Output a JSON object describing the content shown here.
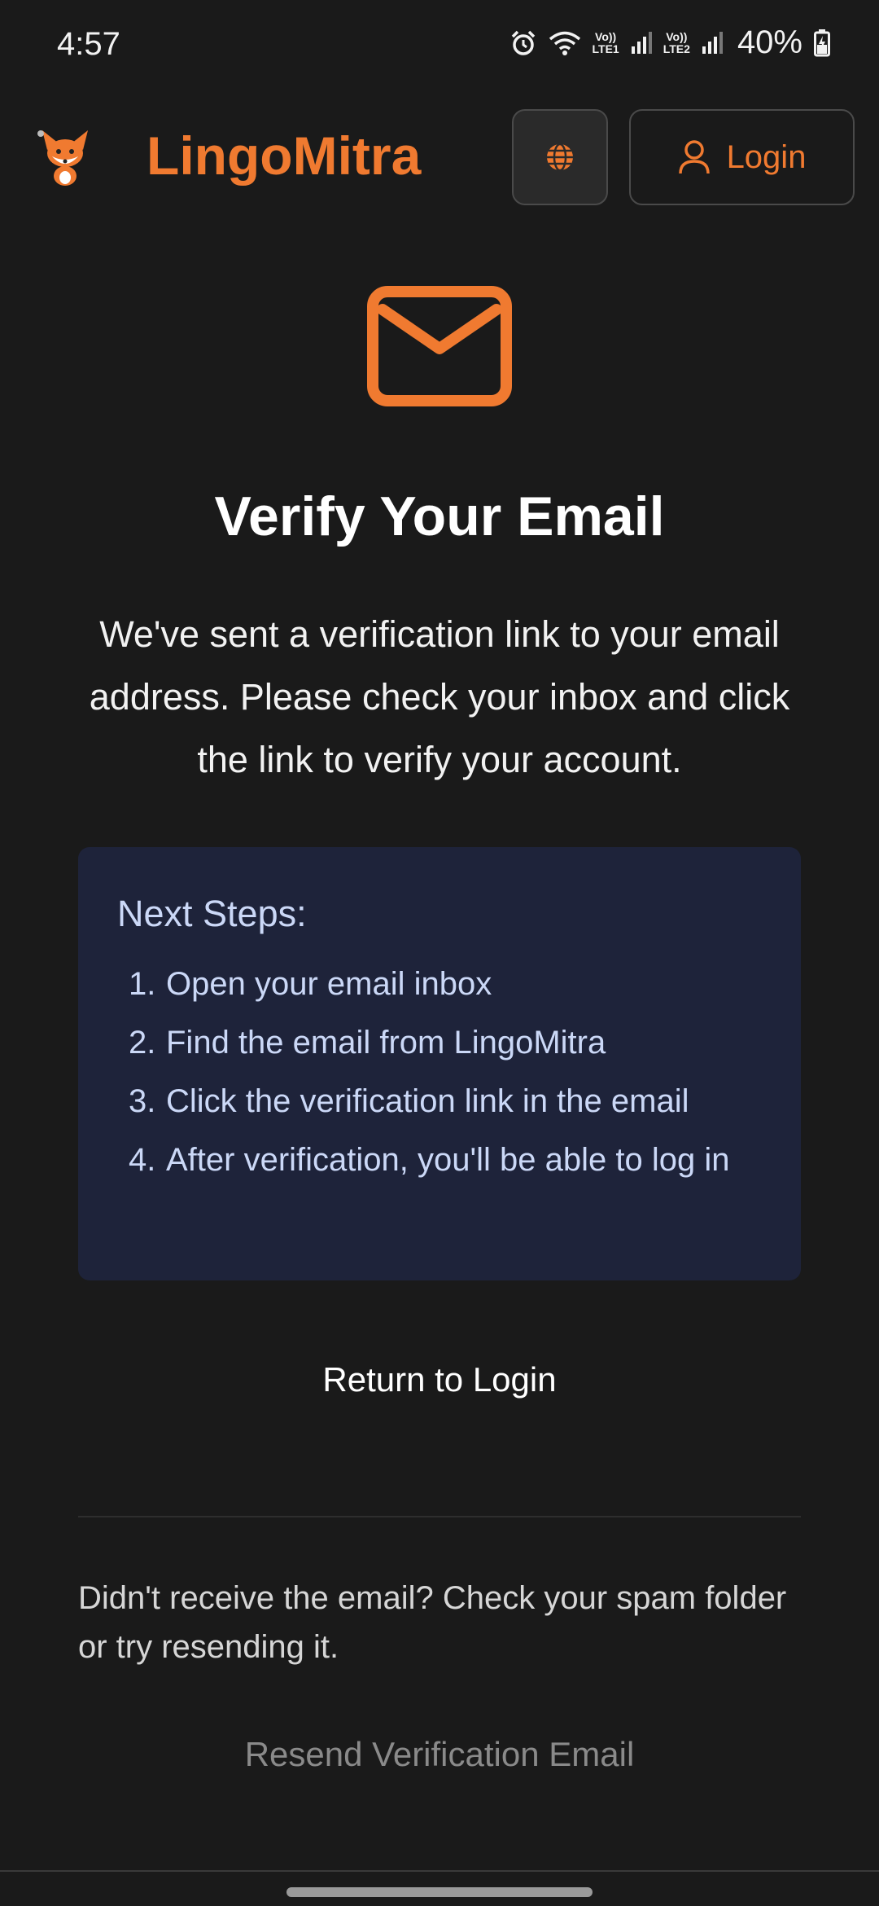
{
  "status_bar": {
    "time": "4:57",
    "sim1": {
      "top": "Vo))",
      "bottom": "LTE1"
    },
    "sim2": {
      "top": "Vo))",
      "bottom": "LTE2"
    },
    "battery": "40%"
  },
  "header": {
    "brand": "LingoMitra",
    "login_label": "Login"
  },
  "main": {
    "title": "Verify Your Email",
    "description": "We've sent a verification link to your email address. Please check your inbox and click the link to verify your account.",
    "steps": {
      "title": "Next Steps:",
      "items": [
        {
          "num": "1.",
          "text": "Open your email inbox"
        },
        {
          "num": "2.",
          "text": "Find the email from LingoMitra"
        },
        {
          "num": "3.",
          "text": "Click the verification link in the email"
        },
        {
          "num": "4.",
          "text": "After verification, you'll be able to log in"
        }
      ]
    },
    "return_label": "Return to Login",
    "help_text": "Didn't receive the email? Check your spam folder or try resending it.",
    "resend_label": "Resend Verification Email"
  },
  "colors": {
    "accent": "#f07a30",
    "background": "#1a1a1a",
    "steps_bg": "#1e233a",
    "steps_text": "#cbd8f7"
  }
}
